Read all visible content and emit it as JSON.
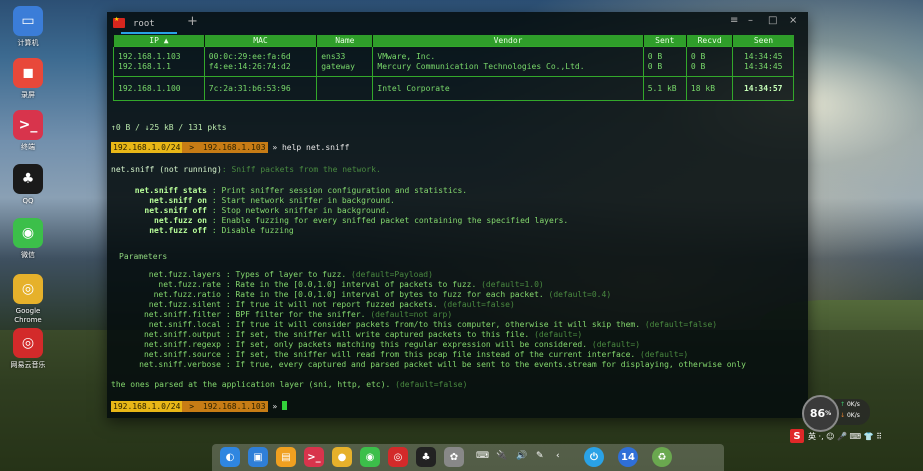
{
  "desktop": {
    "launcher": [
      {
        "label": "计算机",
        "icon": "computer-icon",
        "color": "#3b7dd8"
      },
      {
        "label": "录屏",
        "icon": "screen-recorder-icon",
        "color": "#e8483a"
      },
      {
        "label": "终端",
        "icon": "terminal-icon",
        "color": "#d8344c"
      },
      {
        "label": "QQ",
        "icon": "qq-icon",
        "color": "#1a1a1a"
      },
      {
        "label": "微信",
        "icon": "wechat-icon",
        "color": "#3cbf4a"
      },
      {
        "label": "Google Chrome",
        "icon": "chrome-icon",
        "color": "#e6b12b"
      },
      {
        "label": "网易云音乐",
        "icon": "netease-music-icon",
        "color": "#d32a2a"
      }
    ]
  },
  "terminal": {
    "tab_name": "root",
    "add_tab": "+",
    "controls": {
      "menu": "≡",
      "minimize": "–",
      "maximize": "□",
      "close": "×"
    },
    "hosts": {
      "headers": [
        "IP ▲",
        "MAC",
        "Name",
        "Vendor",
        "Sent",
        "Recvd",
        "Seen"
      ],
      "groups": [
        {
          "ip": [
            "192.168.1.103",
            "192.168.1.1"
          ],
          "mac": [
            "00:0c:29:ee:fa:6d",
            "f4:ee:14:26:74:d2"
          ],
          "name": [
            "ens33",
            "gateway"
          ],
          "vendor": [
            "VMware, Inc.",
            "Mercury Communication Technologies Co.,Ltd."
          ],
          "sent": [
            "0 B",
            "0 B"
          ],
          "recvd": [
            "0 B",
            "0 B"
          ],
          "seen": [
            "14:34:45",
            "14:34:45"
          ]
        },
        {
          "ip": [
            "192.168.1.100"
          ],
          "mac": [
            "7c:2a:31:b6:53:96"
          ],
          "name": [
            ""
          ],
          "vendor": [
            "Intel Corporate"
          ],
          "sent": [
            "5.1 kB"
          ],
          "recvd": [
            "18 kB"
          ],
          "seen": [
            "14:34:57"
          ]
        }
      ]
    },
    "stats": "↑0 B / ↓25 kB / 131 pkts",
    "prompt_net": "192.168.1.0/24",
    "prompt_sep": " > ",
    "prompt_ip": "192.168.1.103",
    "prompt_arrow": " » ",
    "command": "help net.sniff",
    "module_name": "net.sniff",
    "module_state": "(not running)",
    "module_desc": ": Sniff packets from the network.",
    "commands": [
      {
        "name": "net.sniff stats",
        "desc": " : Print sniffer session configuration and statistics."
      },
      {
        "name": "net.sniff on",
        "desc": " : Start network sniffer in background."
      },
      {
        "name": "net.sniff off",
        "desc": " : Stop network sniffer in background."
      },
      {
        "name": "net.fuzz on",
        "desc": " : Enable fuzzing for every sniffed packet containing the specified layers."
      },
      {
        "name": "net.fuzz off",
        "desc": " : Disable fuzzing"
      }
    ],
    "params_title": "Parameters",
    "params": [
      {
        "name": "net.fuzz.layers",
        "desc": " : Types of layer to fuzz. ",
        "def": "(default=Payload)"
      },
      {
        "name": "net.fuzz.rate",
        "desc": " : Rate in the [0.0,1.0] interval of packets to fuzz. ",
        "def": "(default=1.0)"
      },
      {
        "name": "net.fuzz.ratio",
        "desc": " : Rate in the [0.0,1.0] interval of bytes to fuzz for each packet. ",
        "def": "(default=0.4)"
      },
      {
        "name": "net.fuzz.silent",
        "desc": " : If true it will not report fuzzed packets. ",
        "def": "(default=false)"
      },
      {
        "name": "net.sniff.filter",
        "desc": " : BPF filter for the sniffer. ",
        "def": "(default=not arp)"
      },
      {
        "name": "net.sniff.local",
        "desc": " : If true it will consider packets from/to this computer, otherwise it will skip them. ",
        "def": "(default=false)"
      },
      {
        "name": "net.sniff.output",
        "desc": " : If set, the sniffer will write captured packets to this file. ",
        "def": "(default=)"
      },
      {
        "name": "net.sniff.regexp",
        "desc": " : If set, only packets matching this regular expression will be considered. ",
        "def": "(default=)"
      },
      {
        "name": "net.sniff.source",
        "desc": " : If set, the sniffer will read from this pcap file instead of the current interface. ",
        "def": "(default=)"
      },
      {
        "name": "net.sniff.verbose",
        "desc": " : If true, every captured and parsed packet will be sent to the events.stream for displaying, otherwise only",
        "def": ""
      }
    ],
    "verbose_cont": "the ones parsed at the application layer (sni, http, etc). ",
    "verbose_cont_def": "(default=false)"
  },
  "monitor": {
    "cpu": "86",
    "cpu_unit": "%",
    "up": "0",
    "up_unit": "K/s",
    "down": "0",
    "down_unit": "K/s"
  },
  "ime": {
    "logo": "S",
    "text": "英 ·, ☺ 🎤 ⌨ 👕 ⠿"
  },
  "dock": {
    "icons": [
      {
        "name": "launcher-icon",
        "color": "#2f86e0",
        "glyph": "◐"
      },
      {
        "name": "app-store-icon",
        "color": "#2f7fd8",
        "glyph": "▣"
      },
      {
        "name": "file-manager-icon",
        "color": "#f0a020",
        "glyph": "▤"
      },
      {
        "name": "terminal-dock-icon",
        "color": "#d8344c",
        "glyph": ">_"
      },
      {
        "name": "chrome-dock-icon",
        "color": "#e6b12b",
        "glyph": "●"
      },
      {
        "name": "wechat-dock-icon",
        "color": "#3cbf4a",
        "glyph": "◉"
      },
      {
        "name": "netease-dock-icon",
        "color": "#d32a2a",
        "glyph": "◎"
      },
      {
        "name": "qq-dock-icon",
        "color": "#222222",
        "glyph": "♣"
      },
      {
        "name": "settings-dock-icon",
        "color": "#888888",
        "glyph": "✿"
      }
    ],
    "tray": [
      "⌨",
      "🔌",
      "🔊",
      "✎",
      "‹"
    ],
    "power_icon": "⏻",
    "clock_icon": "14",
    "trash_icon": "♻"
  }
}
